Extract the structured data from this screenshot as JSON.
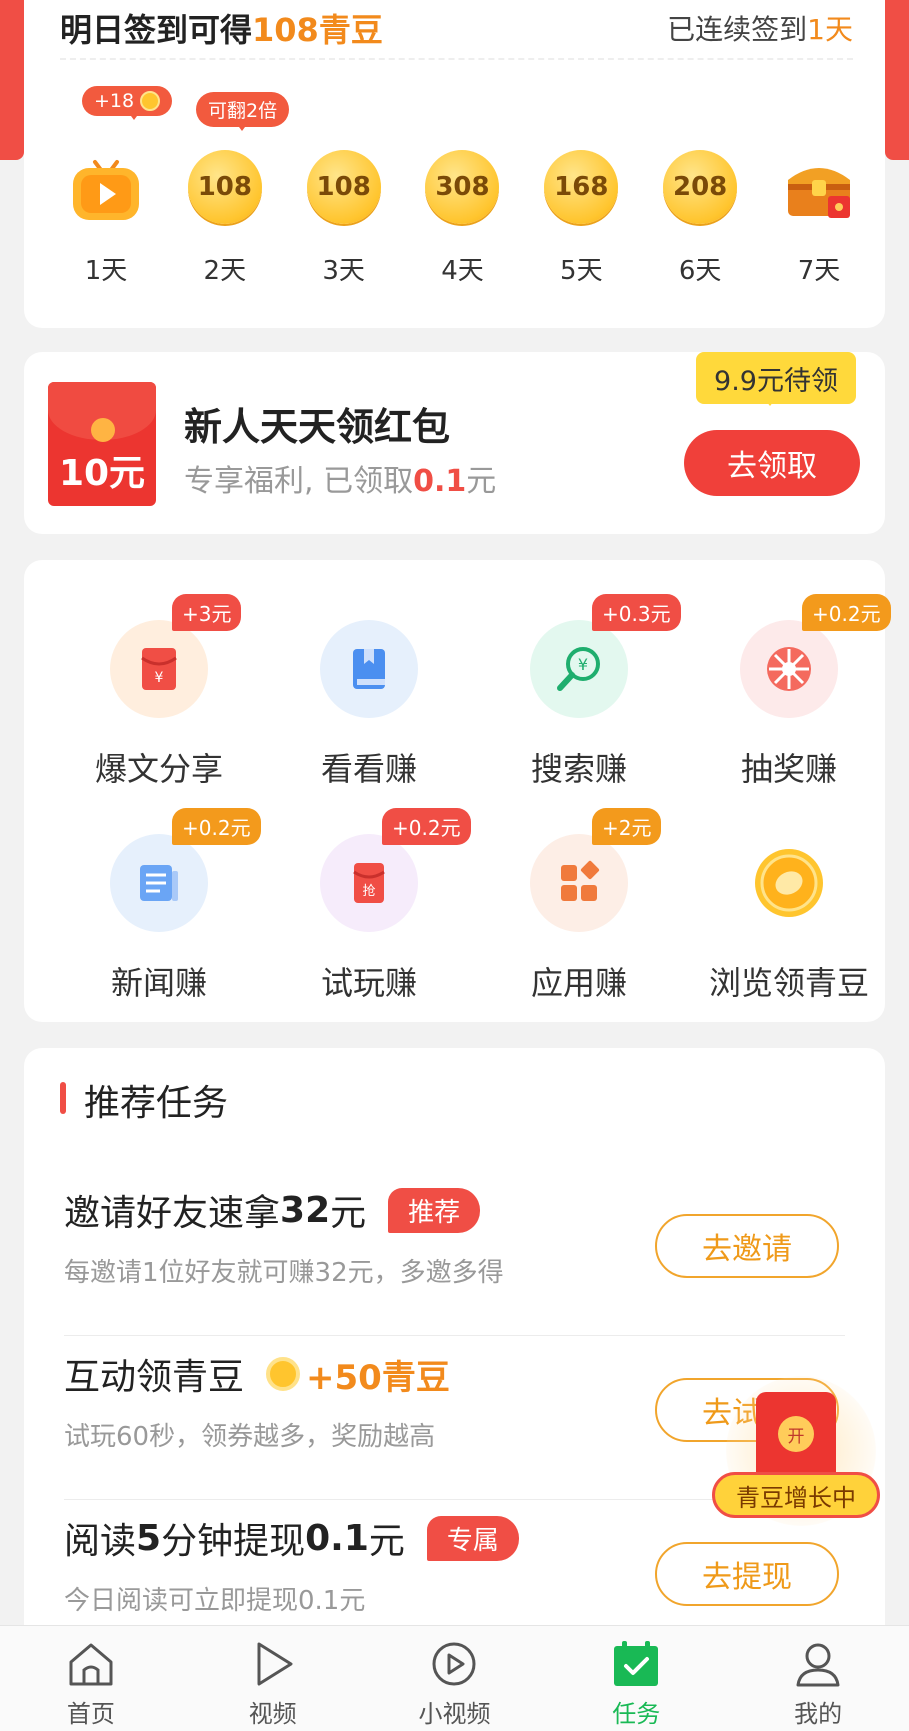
{
  "checkin": {
    "title_prefix": "明日签到可得",
    "title_amount": "108青豆",
    "streak_prefix": "已连续签到",
    "streak_days": "1天",
    "bubble_plus": "+18",
    "bubble_double": "可翻2倍",
    "days": [
      {
        "label": "1天",
        "value": "",
        "icon": "tv-play-icon"
      },
      {
        "label": "2天",
        "value": "108",
        "icon": "coin-icon"
      },
      {
        "label": "3天",
        "value": "108",
        "icon": "coin-icon"
      },
      {
        "label": "4天",
        "value": "308",
        "icon": "coin-icon"
      },
      {
        "label": "5天",
        "value": "168",
        "icon": "coin-icon"
      },
      {
        "label": "6天",
        "value": "208",
        "icon": "coin-icon"
      },
      {
        "label": "7天",
        "value": "",
        "icon": "treasure-chest-icon"
      }
    ]
  },
  "packet": {
    "amount": "10元",
    "title": "新人天天领红包",
    "sub_prefix": "专享福利, 已领取",
    "sub_amount": "0.1",
    "sub_unit": "元",
    "pending": "9.9元待领",
    "button": "去领取"
  },
  "grid": [
    {
      "label": "爆文分享",
      "badge": "+3元",
      "badge_color": "#f04e45",
      "icon": "red-envelope-icon",
      "bg": "#ffeede"
    },
    {
      "label": "看看赚",
      "badge": "",
      "icon": "book-icon",
      "bg": "#e6f0fc"
    },
    {
      "label": "搜索赚",
      "badge": "+0.3元",
      "badge_color": "#f04e45",
      "icon": "search-yuan-icon",
      "bg": "#e3f8ef"
    },
    {
      "label": "抽奖赚",
      "badge": "+0.2元",
      "badge_color": "#f39a1c",
      "icon": "lottery-wheel-icon",
      "bg": "#fdeaea"
    },
    {
      "label": "新闻赚",
      "badge": "+0.2元",
      "badge_color": "#f39a1c",
      "icon": "news-icon",
      "bg": "#e6f0fc"
    },
    {
      "label": "试玩赚",
      "badge": "+0.2元",
      "badge_color": "#f04e45",
      "icon": "grab-envelope-icon",
      "bg": "#f6ecfb"
    },
    {
      "label": "应用赚",
      "badge": "+2元",
      "badge_color": "#f39a1c",
      "icon": "apps-icon",
      "bg": "#fdeee6"
    },
    {
      "label": "浏览领青豆",
      "badge": "",
      "icon": "bean-coin-icon",
      "bg": "transparent"
    }
  ],
  "recommend": {
    "title": "推荐任务",
    "tasks": [
      {
        "name_a": "邀请好友速拿",
        "name_b": "32",
        "name_c": "元",
        "tag": "推荐",
        "desc": "每邀请1位好友就可赚32元，多邀多得",
        "button": "去邀请"
      },
      {
        "name": "互动领青豆",
        "reward": "+50青豆",
        "desc": "试玩60秒，领券越多，奖励越高",
        "button": "去试玩"
      },
      {
        "name_a": "阅读",
        "name_b": "5",
        "name_c": "分钟提现",
        "name_d": "0.1",
        "name_e": "元",
        "tag": "专属",
        "desc": "今日阅读可立即提现0.1元",
        "button": "去提现"
      }
    ]
  },
  "float_widget": {
    "seal": "开",
    "label": "青豆增长中"
  },
  "nav": [
    {
      "label": "首页",
      "icon": "home-icon"
    },
    {
      "label": "视频",
      "icon": "play-icon"
    },
    {
      "label": "小视频",
      "icon": "short-video-icon"
    },
    {
      "label": "任务",
      "icon": "task-calendar-icon",
      "active": true
    },
    {
      "label": "我的",
      "icon": "profile-icon"
    }
  ],
  "colors": {
    "accent_red": "#f04e45",
    "accent_orange": "#f28a1c",
    "active_green": "#19b955"
  }
}
